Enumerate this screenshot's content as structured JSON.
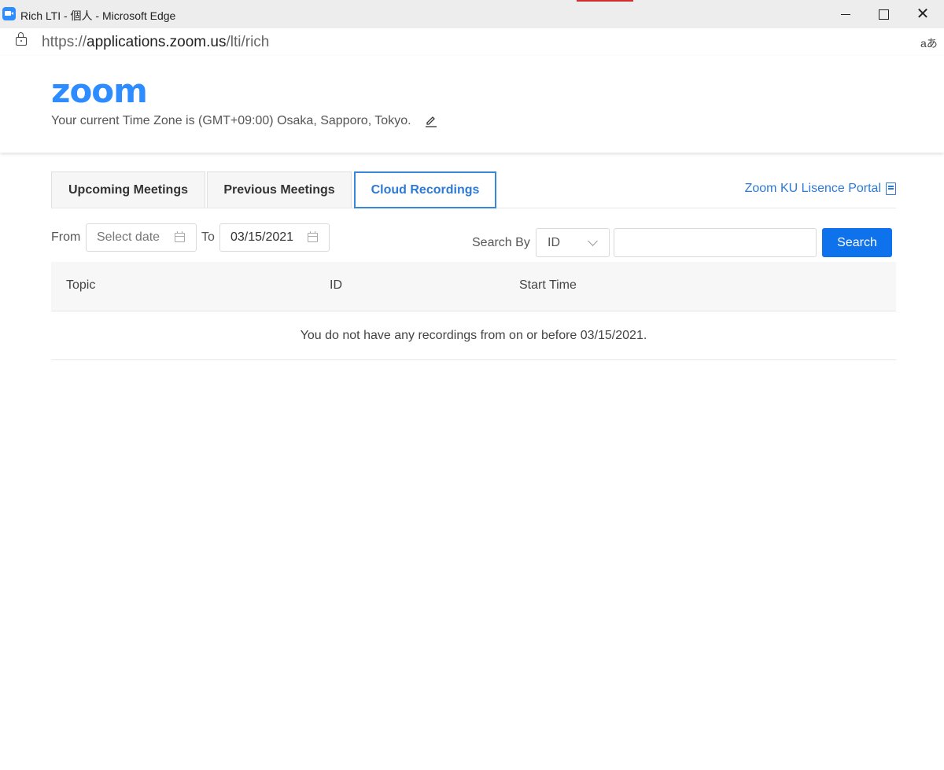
{
  "window": {
    "title": "Rich LTI - 個人 - Microsoft Edge",
    "close_glyph": "✕"
  },
  "addressbar": {
    "url_scheme": "https://",
    "url_host": "applications.zoom.us",
    "url_path": "/lti/rich",
    "read_aloud_glyph": "aあ"
  },
  "header": {
    "logo": "zoom",
    "timezone_text": "Your current Time Zone is (GMT+09:00) Osaka, Sapporo, Tokyo."
  },
  "tabs": [
    {
      "label": "Upcoming Meetings",
      "active": false
    },
    {
      "label": "Previous Meetings",
      "active": false
    },
    {
      "label": "Cloud Recordings",
      "active": true
    }
  ],
  "portal_link": {
    "label": "Zoom KU Lisence Portal"
  },
  "filters": {
    "from_label": "From",
    "from_placeholder": "Select date",
    "to_label": "To",
    "to_value": "03/15/2021",
    "search_by_label": "Search By",
    "search_by_value": "ID",
    "search_value": "",
    "search_button": "Search"
  },
  "table": {
    "columns": [
      "Topic",
      "ID",
      "Start Time"
    ],
    "empty_message": "You do not have any recordings from on or before 03/15/2021."
  },
  "colors": {
    "brand": "#2d8cff",
    "link": "#2d7ad6",
    "button": "#0e72ed"
  }
}
